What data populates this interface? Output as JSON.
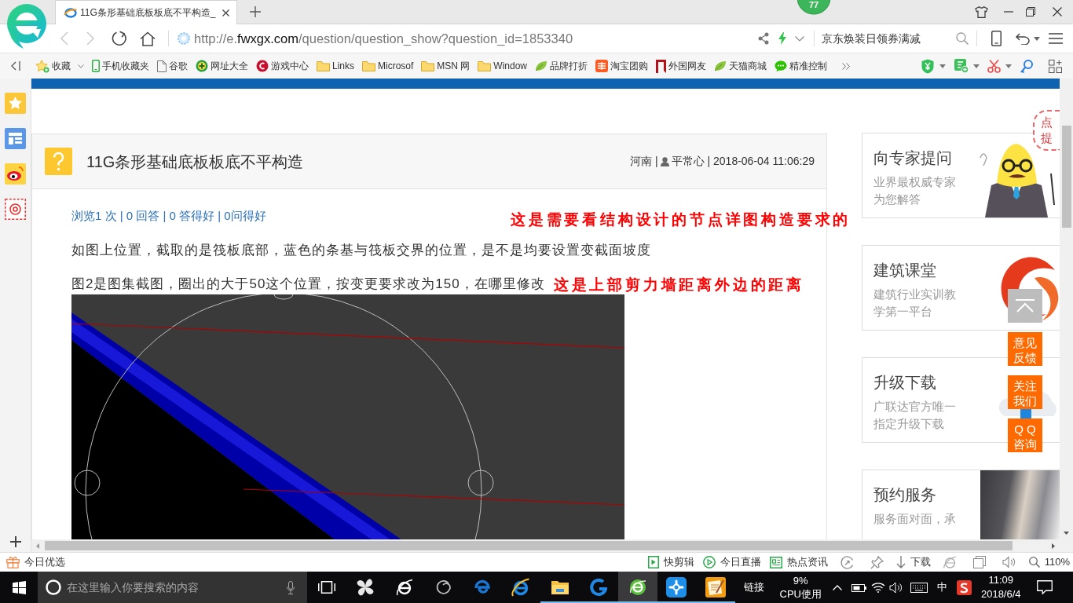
{
  "browser": {
    "tabs": [
      {
        "title": "11G条形基础底板板底不平构造_",
        "selected": true
      }
    ],
    "badge": "77",
    "nav_buttons": [
      {
        "kind": "back",
        "disabled": true
      },
      {
        "kind": "forward",
        "disabled": true
      },
      {
        "kind": "reload",
        "disabled": false
      },
      {
        "kind": "home",
        "disabled": false
      }
    ],
    "address": {
      "parts": [
        {
          "text": "http://e.",
          "kind": "dim"
        },
        {
          "text": "fwxgx.com",
          "kind": "domain"
        },
        {
          "text": "/question/question_show?question_id=1853340",
          "kind": "dim"
        }
      ]
    },
    "search": {
      "placeholder": "京东焕装日领券满减"
    },
    "bookmarks": [
      {
        "label": "收藏",
        "kind": "favorites"
      },
      {
        "label": "手机收藏夹",
        "kind": "phone"
      },
      {
        "label": "谷歌",
        "kind": "page"
      },
      {
        "label": "网址大全",
        "kind": "portal"
      },
      {
        "label": "游戏中心",
        "kind": "game"
      },
      {
        "label": "Links",
        "kind": "folder"
      },
      {
        "label": "Microsof",
        "kind": "folder"
      },
      {
        "label": "MSN 网",
        "kind": "folder"
      },
      {
        "label": "Window",
        "kind": "folder"
      },
      {
        "label": "品牌打折",
        "kind": "leaf"
      },
      {
        "label": "淘宝团购",
        "kind": "tao"
      },
      {
        "label": "外国网友",
        "kind": "flag"
      },
      {
        "label": "天猫商城",
        "kind": "leaf"
      },
      {
        "label": "精准控制",
        "kind": "chat"
      }
    ]
  },
  "question": {
    "title": "11G条形基础底板板底不平构造",
    "meta": [
      {
        "text": "河南 |",
        "kind": "plain"
      },
      {
        "text": "平常心 | 2018-06-04 11:06:29",
        "kind": "user"
      }
    ],
    "stats": {
      "text": "浏览1 次 | 0 回答 | 0 答得好 | 0问得好",
      "note": "这是需要看结构设计的节点详图构造要求的"
    },
    "paragraphs": [
      {
        "text": "如图上位置，截取的是筏板底部，蓝色的条基与筏板交界的位置，是不是均要设置变截面坡度"
      },
      {
        "text": "图2是图集截图，圈出的大于50这个位置，按变更要求改为150，在哪里修改",
        "note": "这是上部剪力墙距离外边的距离"
      }
    ]
  },
  "sidebar_ads": [
    {
      "title": "向专家提问",
      "subtitle": "业界最权威专家为您解答",
      "kind": "mascot",
      "bubble": [
        "点",
        "提"
      ]
    },
    {
      "title": "建筑课堂",
      "subtitle": "建筑行业实训教学第一平台",
      "kind": "logo"
    },
    {
      "title": "升级下载",
      "subtitle": "广联达官方唯一指定升级下载",
      "kind": "cloud"
    },
    {
      "title": "预约服务",
      "subtitle": "服务面对面，承",
      "kind": "photo"
    }
  ],
  "float_buttons": [
    {
      "kind": "top"
    },
    {
      "kind": "text",
      "lines": [
        "意见",
        "反馈"
      ]
    },
    {
      "kind": "text",
      "lines": [
        "关注",
        "我们"
      ]
    },
    {
      "kind": "text",
      "lines": [
        "Q Q",
        "咨询"
      ]
    }
  ],
  "status_bar": {
    "left": {
      "label": "今日优选"
    },
    "items": [
      {
        "kind": "clip",
        "label": "快剪辑"
      },
      {
        "kind": "live",
        "label": "今日直播"
      },
      {
        "kind": "news",
        "label": "热点资讯"
      },
      {
        "kind": "speed"
      },
      {
        "kind": "pin"
      },
      {
        "kind": "download",
        "label": "下载"
      },
      {
        "kind": "ie"
      },
      {
        "kind": "window"
      },
      {
        "kind": "sound"
      },
      {
        "kind": "zoom",
        "label": "110%"
      }
    ]
  },
  "taskbar": {
    "search": {
      "placeholder": "在这里输入你要搜索的内容"
    },
    "apps": [
      {
        "kind": "taskview",
        "running": false,
        "selected": false
      },
      {
        "kind": "pinwheel",
        "running": false,
        "selected": false
      },
      {
        "kind": "ieoutline",
        "running": false,
        "selected": false
      },
      {
        "kind": "swirl",
        "running": false,
        "selected": false
      },
      {
        "kind": "edge",
        "running": false,
        "selected": false
      },
      {
        "kind": "ie",
        "running": false,
        "selected": false
      },
      {
        "kind": "explorer",
        "running": true,
        "selected": false
      },
      {
        "kind": "gapp",
        "running": true,
        "selected": false
      },
      {
        "kind": "sphere",
        "running": true,
        "selected": true
      },
      {
        "kind": "remote",
        "running": true,
        "selected": false
      },
      {
        "kind": "notes",
        "running": true,
        "selected": false
      }
    ],
    "links_label": "链接",
    "cpu": {
      "value": "9%",
      "label": "CPU使用"
    },
    "ime": "中",
    "clock": {
      "time": "11:09",
      "date": "2018/6/4"
    }
  }
}
